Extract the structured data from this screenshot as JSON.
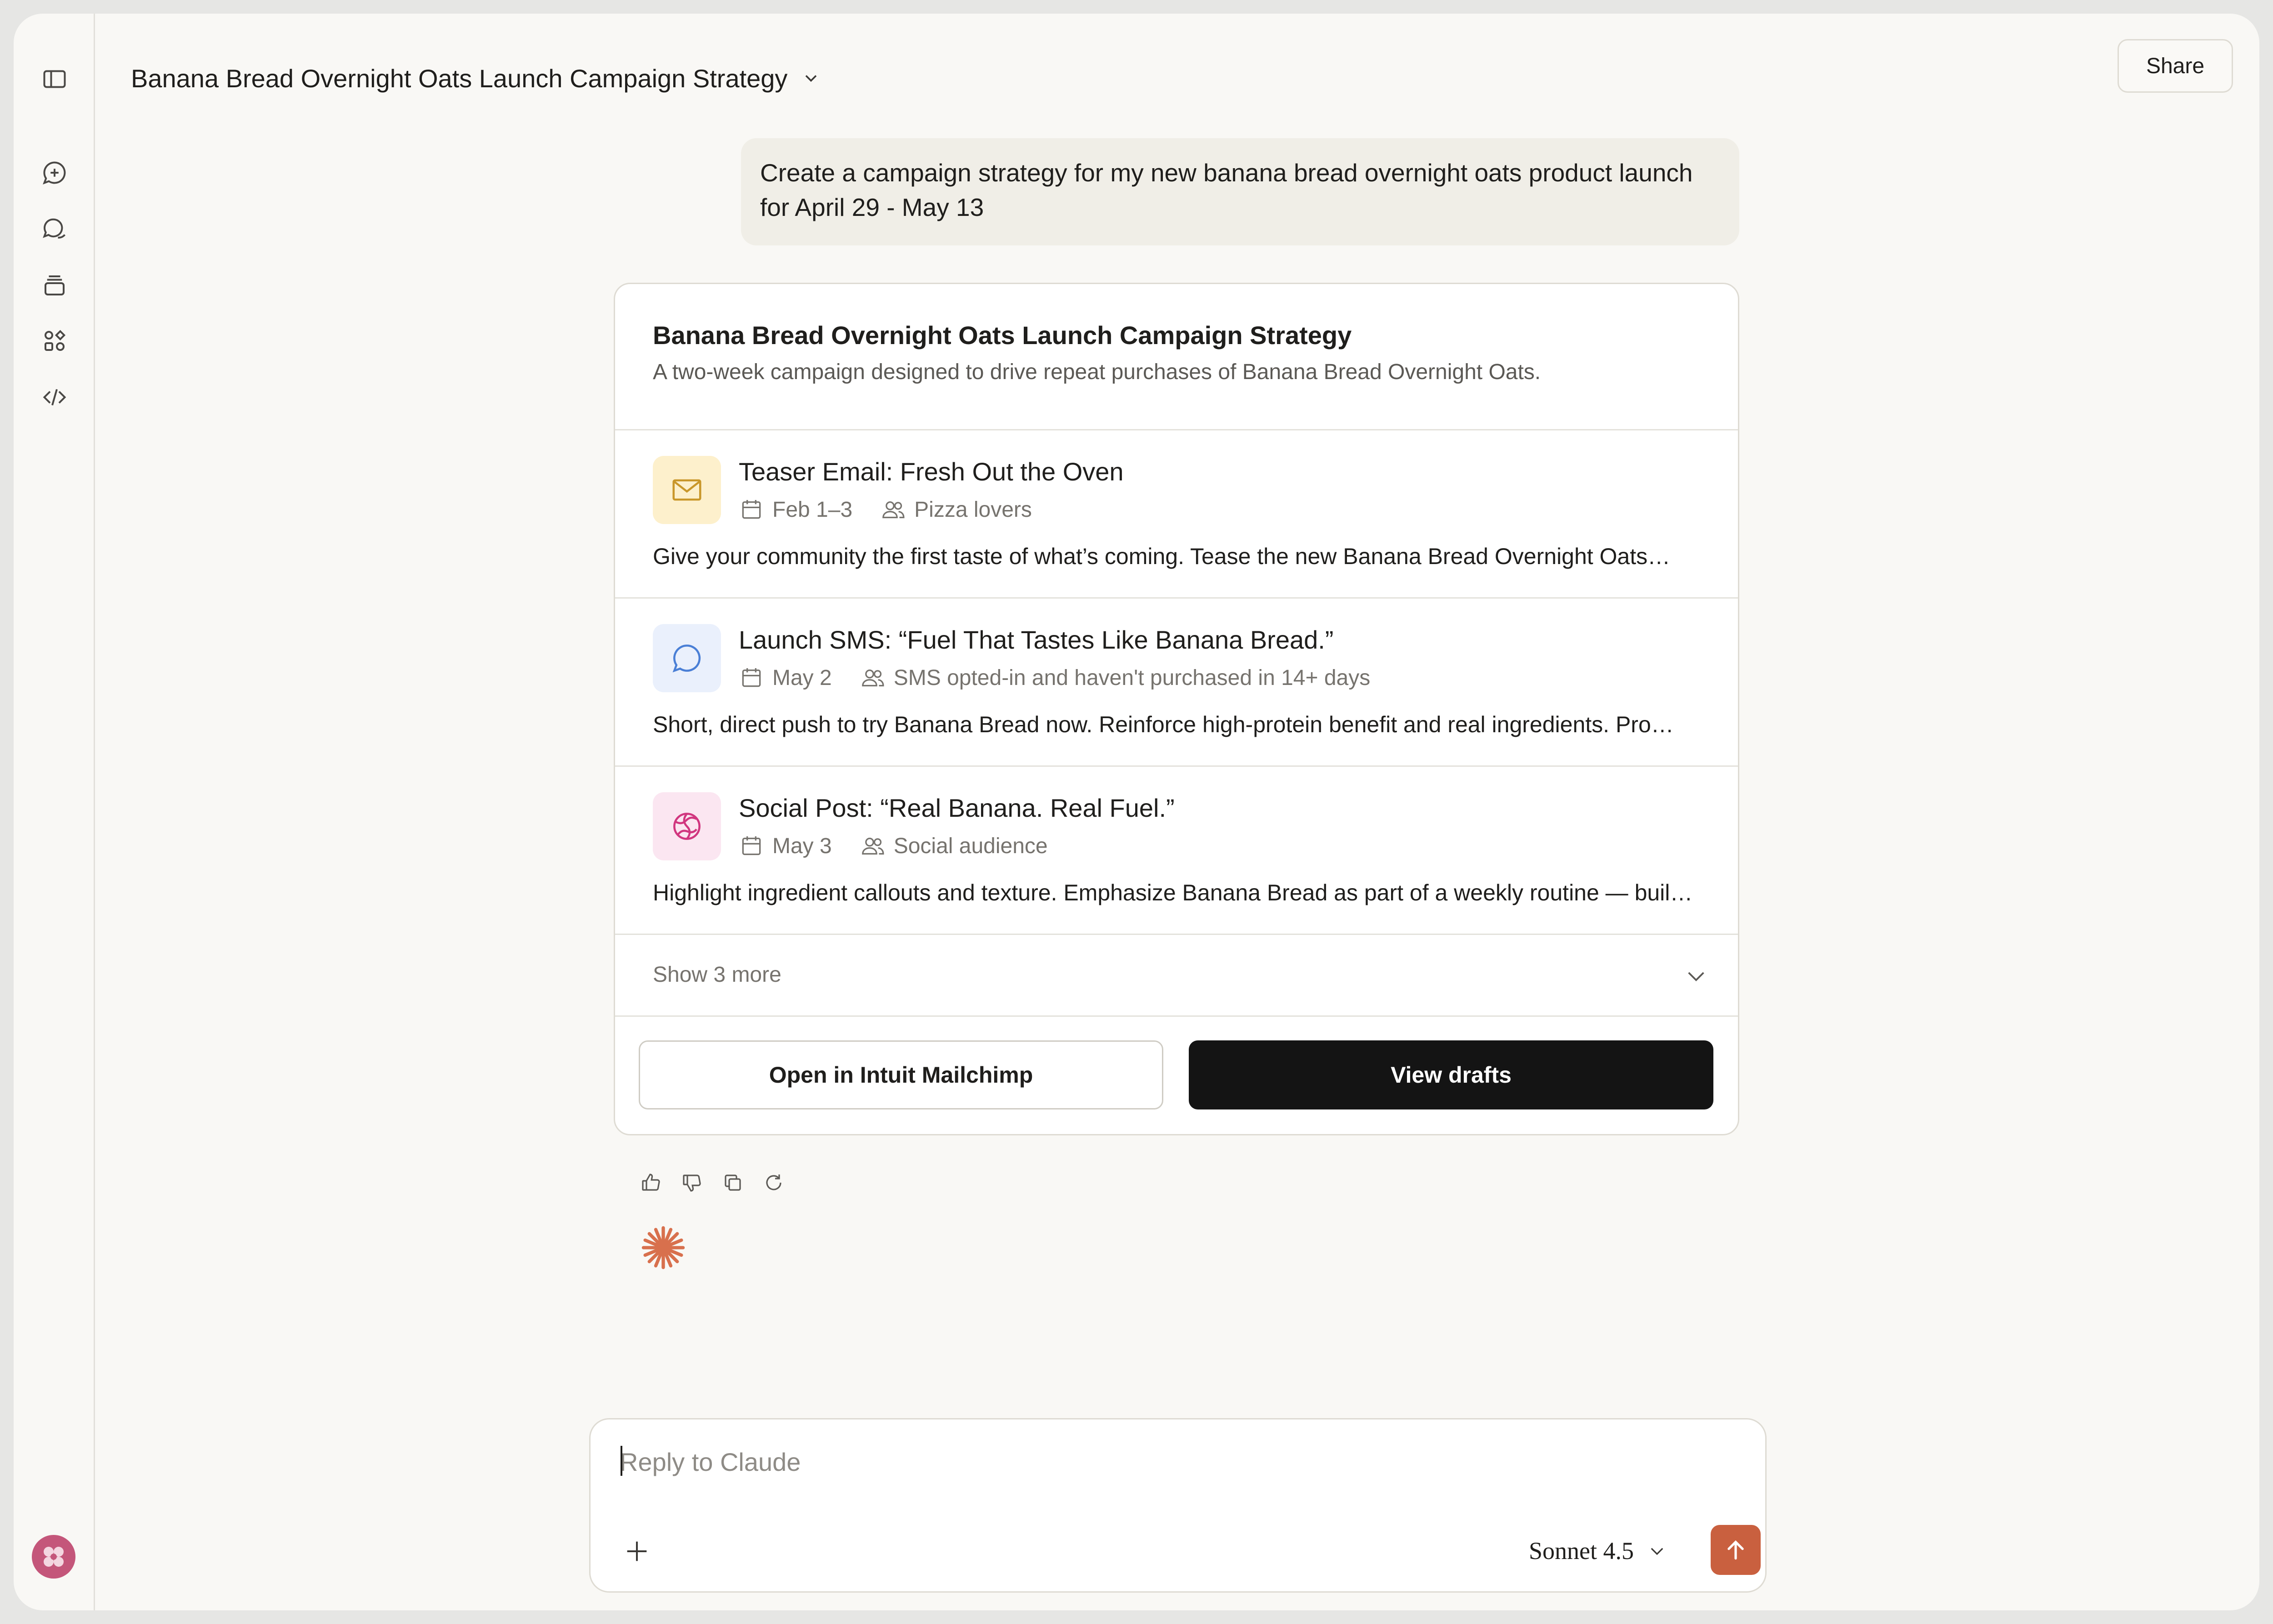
{
  "header": {
    "title": "Banana Bread Overnight Oats Launch Campaign Strategy",
    "share_label": "Share"
  },
  "sidebar": {
    "items": [
      {
        "icon": "sidebar-toggle-icon"
      },
      {
        "icon": "new-chat-icon"
      },
      {
        "icon": "chats-icon"
      },
      {
        "icon": "projects-icon"
      },
      {
        "icon": "artifacts-icon"
      },
      {
        "icon": "code-icon"
      }
    ],
    "avatar_color": "#c4567a"
  },
  "conversation": {
    "user_message": "Create a campaign strategy for my new banana bread overnight oats product launch for April 29 - May 13"
  },
  "campaign": {
    "title": "Banana Bread Overnight Oats Launch Campaign Strategy",
    "subtitle": "A two-week campaign designed to drive repeat purchases of Banana Bread Overnight Oats.",
    "items": [
      {
        "icon": "mail-icon",
        "icon_bg": "#fdf0cc",
        "icon_color": "#c9972a",
        "title": "Teaser Email: Fresh Out the Oven",
        "date": "Feb 1–3",
        "audience": "Pizza lovers",
        "description": "Give your community the first taste of what’s coming. Tease the new Banana Bread Overnight Oats…"
      },
      {
        "icon": "chat-bubble-icon",
        "icon_bg": "#eaf0fc",
        "icon_color": "#4a7fd6",
        "title": "Launch SMS: “Fuel That Tastes Like Banana Bread.”",
        "date": "May 2",
        "audience": "SMS opted-in and haven't purchased in 14+ days",
        "description": "Short, direct push to try Banana Bread now. Reinforce high-protein benefit and real ingredients. Pro…"
      },
      {
        "icon": "globe-icon",
        "icon_bg": "#fbe6f1",
        "icon_color": "#d1367f",
        "title": "Social Post: “Real Banana. Real Fuel.”",
        "date": "May 3",
        "audience": "Social audience",
        "description": "Highlight ingredient callouts and texture. Emphasize Banana Bread as part of a weekly routine — buil…"
      }
    ],
    "show_more_label": "Show 3 more",
    "open_button_label": "Open in Intuit Mailchimp",
    "drafts_button_label": "View drafts"
  },
  "composer": {
    "placeholder": "Reply to Claude",
    "value": "",
    "model": "Sonnet 4.5",
    "send_color": "#c9603f"
  },
  "colors": {
    "accent": "#c9603f",
    "background": "#f9f8f5",
    "primary_button": "#141414"
  }
}
